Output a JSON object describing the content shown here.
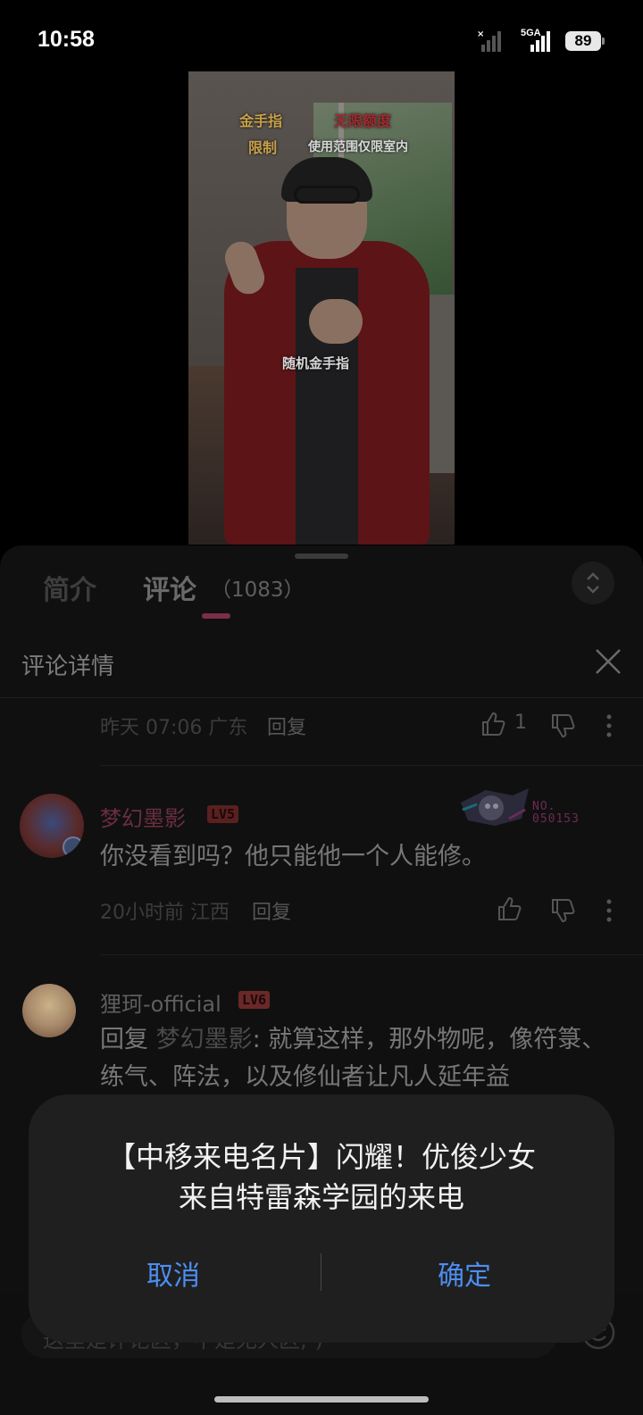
{
  "status_bar": {
    "time": "10:58",
    "network": "5GA",
    "battery": "89"
  },
  "video": {
    "captions": {
      "golden_finger": "金手指",
      "unlimited": "无限额度",
      "limit": "限制",
      "indoor_only": "使用范围仅限室内",
      "random": "随机金手指"
    }
  },
  "tabs": [
    {
      "label": "简介"
    },
    {
      "label": "评论",
      "count": "（1083）"
    }
  ],
  "detail": {
    "title": "评论详情"
  },
  "comments": [
    {
      "meta": "昨天 07:06 广东",
      "reply": "回复",
      "likes": "1"
    },
    {
      "username": "梦幻墨影",
      "level": "LV5",
      "text": "你没看到吗？他只能他一个人能修。",
      "meta": "20小时前 江西",
      "reply": "回复",
      "badge": {
        "line1": "NO.",
        "line2": "050153"
      }
    },
    {
      "username": "狸珂-official",
      "level": "LV6",
      "reply_prefix": "回复 ",
      "reply_to": "梦幻墨影",
      "text": ": 就算这样，那外物呢，像符箓、练气、阵法，以及修仙者让凡人延年益"
    }
  ],
  "input": {
    "placeholder": "这里是评论区，不是无人区;-)"
  },
  "dialog": {
    "line1": "【中移来电名片】闪耀！优俊少女",
    "line2": "来自特雷森学园的来电",
    "cancel": "取消",
    "confirm": "确定"
  },
  "colors": {
    "accent": "#4d8ef0",
    "pink": "#7a2f48",
    "level": "#8a2e2e"
  }
}
